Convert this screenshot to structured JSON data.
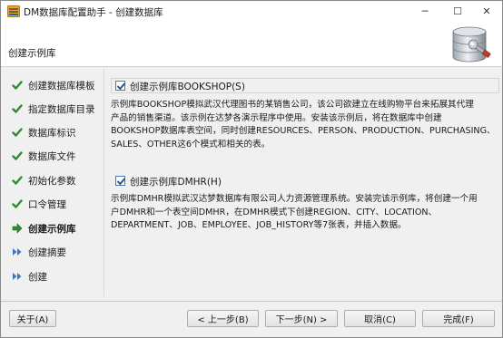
{
  "window": {
    "title": "DM数据库配置助手 - 创建数据库",
    "icon": "dm-app-icon",
    "controls": {
      "minimize": "─",
      "maximize": "☐",
      "close": "✕"
    }
  },
  "header": {
    "title": "创建示例库",
    "graphic": "database-wrench-icon"
  },
  "nav": {
    "items": [
      {
        "label": "创建数据库模板",
        "state": "done"
      },
      {
        "label": "指定数据库目录",
        "state": "done"
      },
      {
        "label": "数据库标识",
        "state": "done"
      },
      {
        "label": "数据库文件",
        "state": "done"
      },
      {
        "label": "初始化参数",
        "state": "done"
      },
      {
        "label": "口令管理",
        "state": "done"
      },
      {
        "label": "创建示例库",
        "state": "current"
      },
      {
        "label": "创建摘要",
        "state": "pending"
      },
      {
        "label": "创建",
        "state": "pending"
      }
    ],
    "colors": {
      "done": "#2e8b2e",
      "current": "#2e8b2e",
      "pending": "#3a78c8"
    }
  },
  "main": {
    "bookshop": {
      "checked": true,
      "label": "创建示例库BOOKSHOP(S)",
      "description_lines": [
        "示例库BOOKSHOP模拟武汉代理图书的某销售公司，该公司欲建立在线购物平台来拓展其代理",
        "产品的销售渠道。该示例在达梦各演示程序中使用。安装该示例后，将在数据库中创建",
        "BOOKSHOP数据库表空间，同时创建RESOURCES、PERSON、PRODUCTION、PURCHASING、",
        "SALES、OTHER这6个模式和相关的表。"
      ]
    },
    "dmhr": {
      "checked": true,
      "label": "创建示例库DMHR(H)",
      "description_lines": [
        "示例库DMHR模拟武汉达梦数据库有限公司人力资源管理系统。安装完该示例库，将创建一个用",
        "户DMHR和一个表空间DMHR，在DMHR模式下创建REGION、CITY、LOCATION、",
        "DEPARTMENT、JOB、EMPLOYEE、JOB_HISTORY等7张表，并插入数据。"
      ]
    }
  },
  "buttons": {
    "about": "关于(A)",
    "prev": "< 上一步(B)",
    "next": "下一步(N) >",
    "cancel": "取消(C)",
    "finish": "完成(F)"
  }
}
